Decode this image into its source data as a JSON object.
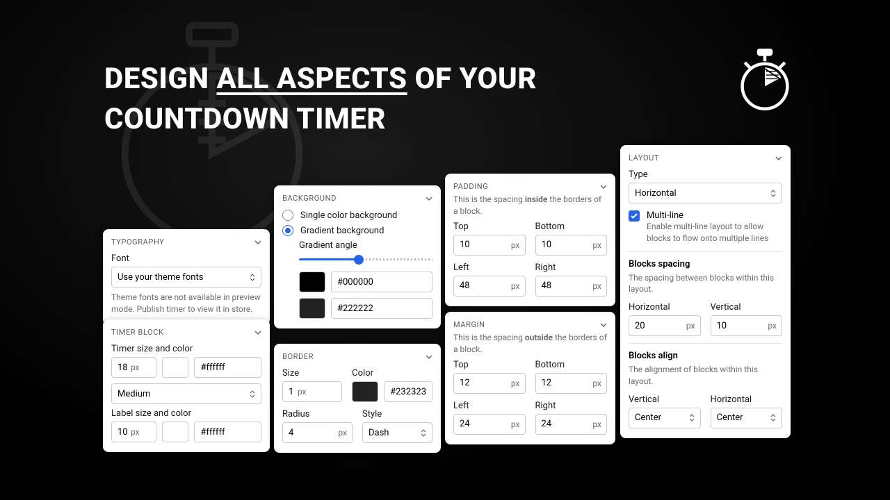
{
  "headline": {
    "pre": "DESIGN ",
    "underlined": "ALL ASPECTS",
    "post": " OF YOUR",
    "line2": "COUNTDOWN TIMER"
  },
  "typography": {
    "header": "TYPOGRAPHY",
    "font_label": "Font",
    "font_value": "Use your theme fonts",
    "note": "Theme fonts are not available in preview mode. Publish timer to view it in store."
  },
  "timerblock": {
    "header": "TIMER BLOCK",
    "timer_label": "Timer size and color",
    "timer_size": "18",
    "timer_unit": "px",
    "timer_color": "#ffffff",
    "weight": "Medium",
    "label_label": "Label size and color",
    "label_size": "10",
    "label_unit": "px",
    "label_color": "#ffffff"
  },
  "background": {
    "header": "BACKGROUND",
    "opt_single": "Single color background",
    "opt_gradient": "Gradient background",
    "angle_label": "Gradient angle",
    "color1": "#000000",
    "swatch1": "#000000",
    "color2": "#222222",
    "swatch2": "#222222"
  },
  "border": {
    "header": "BORDER",
    "size_label": "Size",
    "size": "1",
    "size_unit": "px",
    "color_label": "Color",
    "color_swatch": "#232323",
    "color": "#232323",
    "radius_label": "Radius",
    "radius": "4",
    "radius_unit": "px",
    "style_label": "Style",
    "style": "Dash"
  },
  "padding": {
    "header": "PADDING",
    "desc_pre": "This is the spacing ",
    "desc_b": "inside",
    "desc_post": " the borders of a block.",
    "top_l": "Top",
    "top": "10",
    "bottom_l": "Bottom",
    "bottom": "10",
    "left_l": "Left",
    "left": "48",
    "right_l": "Right",
    "right": "48",
    "unit": "px"
  },
  "margin": {
    "header": "MARGIN",
    "desc_pre": "This is the spacing ",
    "desc_b": "outside",
    "desc_post": " the borders of a block.",
    "top_l": "Top",
    "top": "12",
    "bottom_l": "Bottom",
    "bottom": "12",
    "left_l": "Left",
    "left": "24",
    "right_l": "Right",
    "right": "24",
    "unit": "px"
  },
  "layout": {
    "header": "LAYOUT",
    "type_l": "Type",
    "type": "Horizontal",
    "ml_label": "Multi-line",
    "ml_desc": "Enable multi-line layout to allow blocks to flow onto multiple lines",
    "spacing_title": "Blocks spacing",
    "spacing_desc": "The spacing between blocks within this layout.",
    "h_l": "Horizontal",
    "h": "20",
    "v_l": "Vertical",
    "v": "10",
    "unit": "px",
    "align_title": "Blocks align",
    "align_desc": "The alignment of blocks within this layout.",
    "av_l": "Vertical",
    "av": "Center",
    "ah_l": "Horizontal",
    "ah": "Center"
  }
}
